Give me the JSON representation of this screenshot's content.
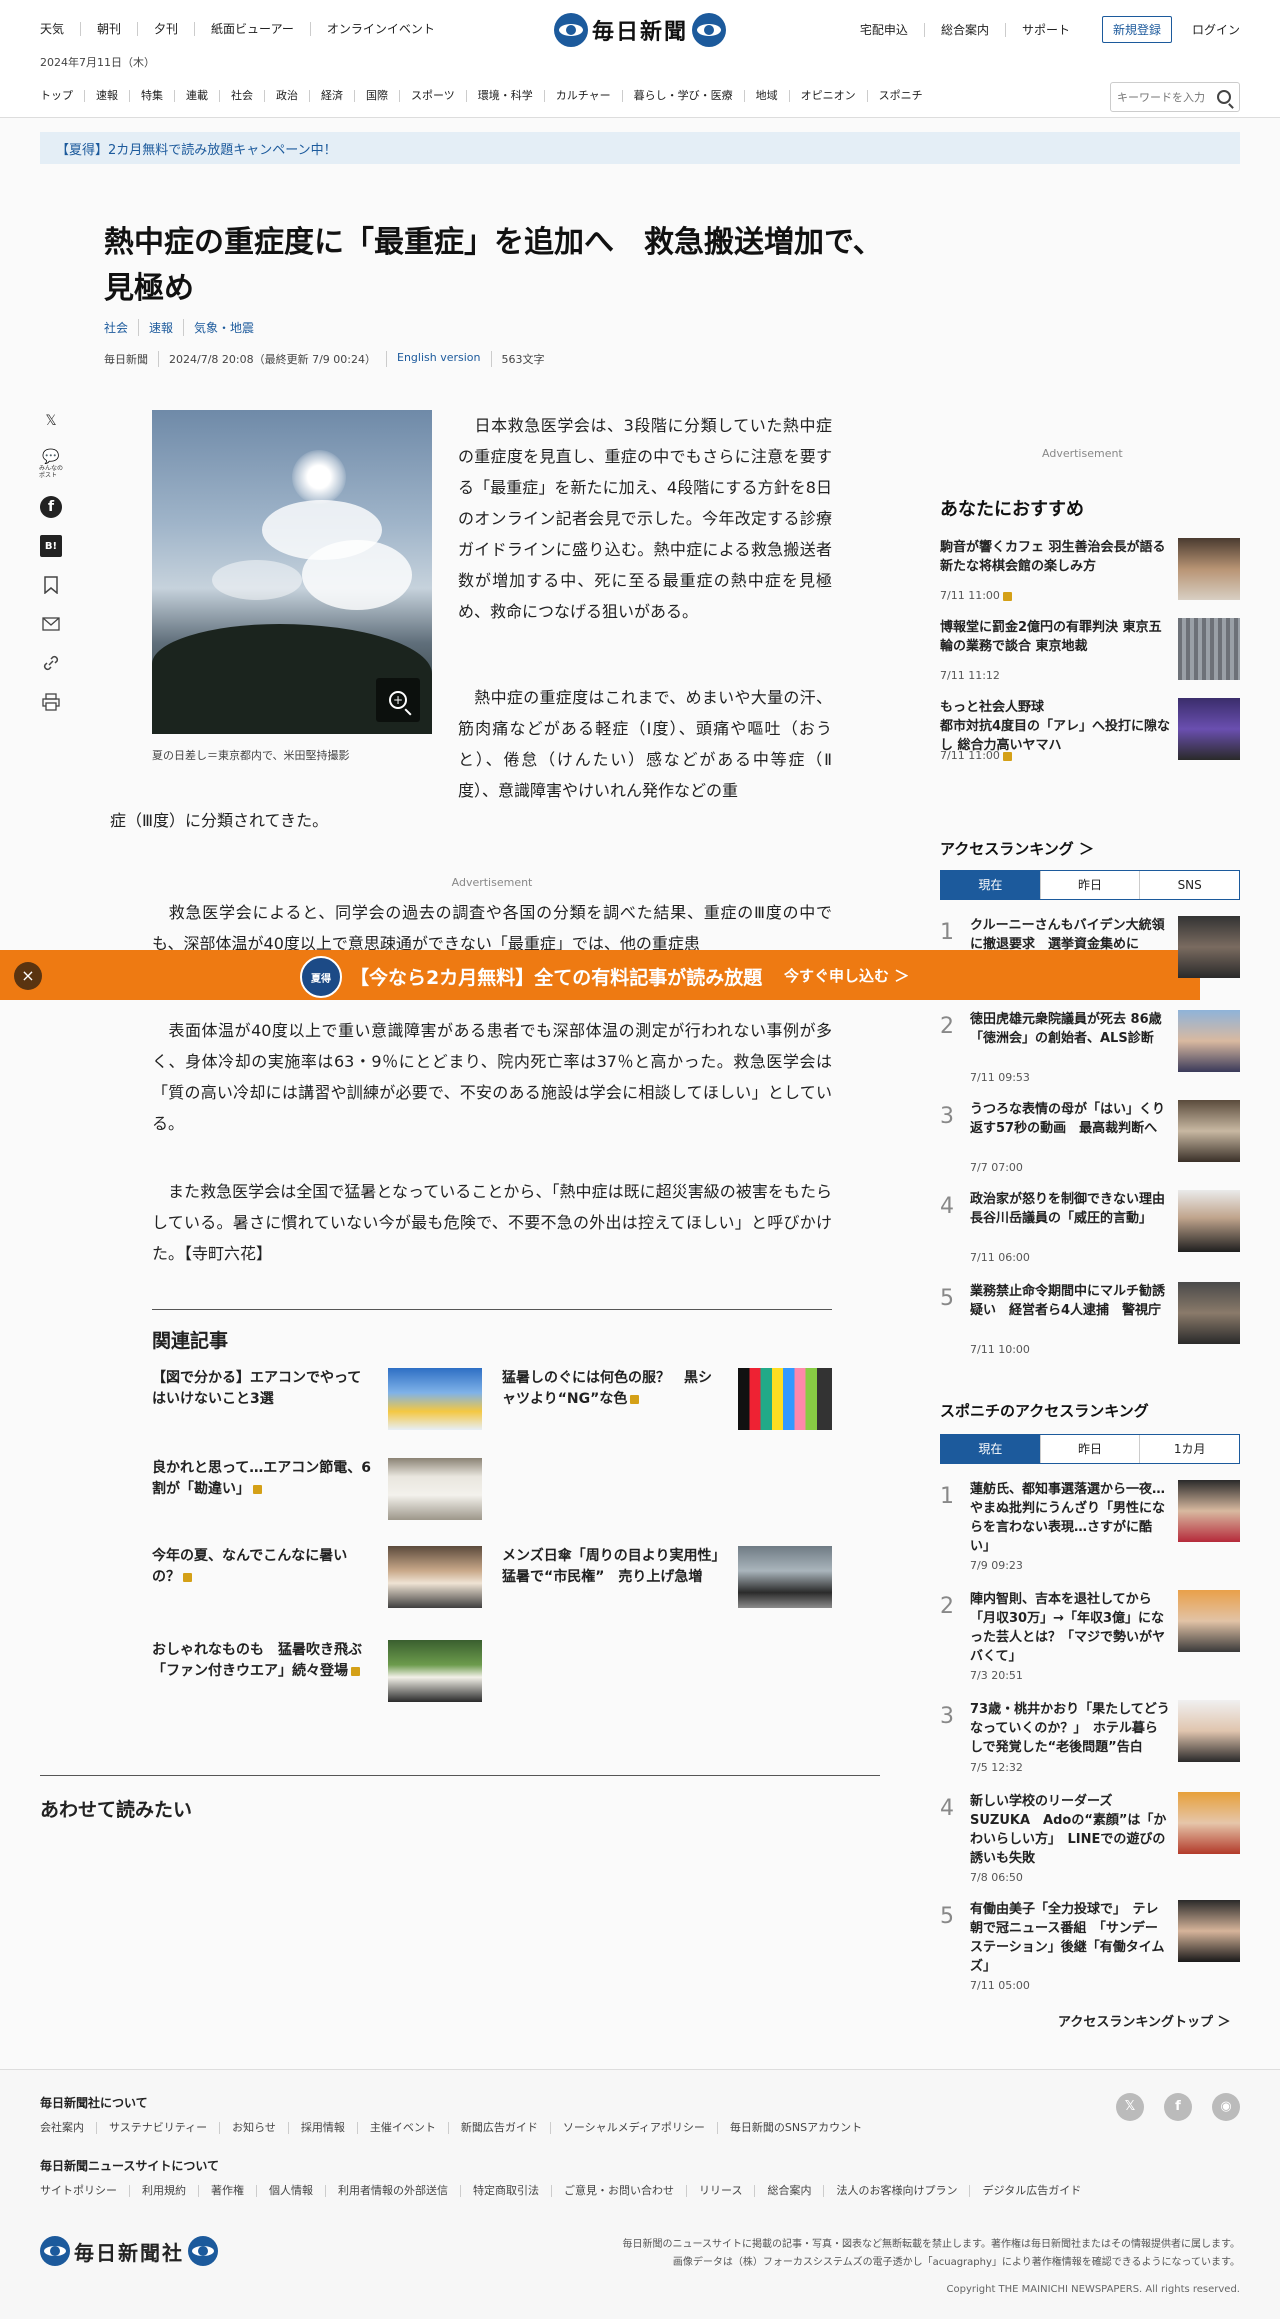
{
  "header": {
    "top_nav": [
      "天気",
      "朝刊",
      "夕刊",
      "紙面ビューアー",
      "オンラインイベント"
    ],
    "date": "2024年7月11日（木）",
    "logo_text": "毎日新聞",
    "right_nav": [
      "宅配申込",
      "総合案内",
      "サポート"
    ],
    "register": "新規登録",
    "login": "ログイン",
    "categories": [
      "トップ",
      "速報",
      "特集",
      "連載",
      "社会",
      "政治",
      "経済",
      "国際",
      "スポーツ",
      "環境・科学",
      "カルチャー",
      "暮らし・学び・医療",
      "地域",
      "オピニオン",
      "スポニチ"
    ],
    "search_placeholder": "キーワードを入力"
  },
  "promo": "【夏得】2カ月無料で読み放題キャンペーン中！",
  "article": {
    "headline": "熱中症の重症度に「最重症」を追加へ　救急搬送増加で、見極め",
    "tags": [
      "社会",
      "速報",
      "気象・地震"
    ],
    "meta": [
      "毎日新聞",
      "2024/7/8 20:08（最終更新 7/9 00:24）",
      "English version",
      "563文字"
    ],
    "share_icons": [
      "x-icon",
      "comment-icon",
      "facebook-icon",
      "hatena-icon",
      "bookmark-icon",
      "mail-icon",
      "link-icon",
      "print-icon"
    ],
    "comment_label": "みんなの\nポスト",
    "caption": "夏の日差し＝東京都内で、米田堅持撮影",
    "p1": "　日本救急医学会は、3段階に分類していた熱中症の重症度を見直し、重症の中でもさらに注意を要する「最重症」を新たに加え、4段階にする方針を8日のオンライン記者会見で示した。今年改定する診療ガイドラインに盛り込む。熱中症による救急搬送者数が増加する中、死に至る最重症の熱中症を見極め、救命につなげる狙いがある。",
    "p2a": "　熱中症の重症度はこれまで、めまいや大量の汗、筋肉痛などがある軽症（Ⅰ度）、頭痛や嘔吐（おうと）、倦怠（けんたい）感などがある中等症（Ⅱ度）、意識障害やけいれん発作などの重",
    "p2b": "症（Ⅲ度）に分類されてきた。",
    "ad_label": "Advertisement",
    "p3": "　救急医学会によると、同学会の過去の調査や各国の分類を調べた結果、重症のⅢ度の中でも、深部体温が40度以上で意思疎通ができない「最重症」では、他の重症患",
    "p4": "　表面体温が40度以上で重い意識障害がある患者でも深部体温の測定が行われない事例が多く、身体冷却の実施率は63・9％にとどまり、院内死亡率は37％と高かった。救急医学会は「質の高い冷却には講習や訓練が必要で、不安のある施設は学会に相談してほしい」としている。",
    "p5": "　また救急医学会は全国で猛暑となっていることから、「熱中症は既に超災害級の被害をもたらしている。暑さに慣れていない今が最も危険で、不要不急の外出は控えてほしい」と呼びかけた。【寺町六花】"
  },
  "banner": {
    "badge": "夏得",
    "text": "【今なら2カ月無料】全ての有料記事が読み放題",
    "cta": "今すぐ申し込む ＞",
    "close": "×"
  },
  "related": {
    "title": "関連記事",
    "items": [
      {
        "title": "【図で分かる】エアコンでやってはいけないこと3選",
        "locked": false
      },
      {
        "title": "猛暑しのぐには何色の服？　黒シャツより“NG”な色",
        "locked": true
      },
      {
        "title": "良かれと思って…エアコン節電、6割が「勘違い」",
        "locked": true
      },
      {
        "title": "今年の夏、なんでこんなに暑いの？",
        "locked": true
      },
      {
        "title": "メンズ日傘「周りの目より実用性」　猛暑で“市民権”　売り上げ急増",
        "locked": false
      },
      {
        "title": "おしゃれなものも　猛暑吹き飛ぶ「ファン付きウエア」続々登場",
        "locked": true
      }
    ]
  },
  "also_read": "あわせて読みたい",
  "sidebar": {
    "ad_label": "Advertisement",
    "rec_title": "あなたにおすすめ",
    "rec": [
      {
        "title": "駒音が響くカフェ 羽生善治会長が語る新たな将棋会館の楽しみ方",
        "time": "7/11 11:00",
        "locked": true
      },
      {
        "title": "博報堂に罰金2億円の有罪判決 東京五輪の業務で談合 東京地裁",
        "time": "7/11 11:12",
        "locked": false
      },
      {
        "title": "もっと社会人野球\n都市対抗4度目の「アレ」へ投打に隙なし 総合力高いヤマハ",
        "time": "7/11 11:00",
        "locked": true
      }
    ],
    "ranking_title": "アクセスランキング ＞",
    "ranking_tabs": [
      "現在",
      "昨日",
      "SNS"
    ],
    "ranking": [
      {
        "title": "クルーニーさんもバイデン大統領に撤退要求　選挙資金集めに",
        "time": ""
      },
      {
        "title": "徳田虎雄元衆院議員が死去 86歳 「徳洲会」の創始者、ALS診断",
        "time": "7/11 09:53"
      },
      {
        "title": "うつろな表情の母が「はい」くり返す57秒の動画　最高裁判断へ",
        "time": "7/7 07:00"
      },
      {
        "title": "政治家が怒りを制御できない理由　長谷川岳議員の「威圧的言動」",
        "time": "7/11 06:00"
      },
      {
        "title": "業務禁止命令期間中にマルチ勧誘疑い　経営者ら4人逮捕　警視庁",
        "time": "7/11 10:00"
      }
    ],
    "spn_title": "スポニチのアクセスランキング",
    "spn_tabs": [
      "現在",
      "昨日",
      "1カ月"
    ],
    "spn": [
      {
        "title": "蓮舫氏、都知事選落選から一夜…やまぬ批判にうんざり「男性にならを言わない表現…さすがに酷い」",
        "time": "7/9 09:23"
      },
      {
        "title": "陣内智則、吉本を退社してから「月収30万」→「年収3億」になった芸人とは？「マジで勢いがヤバくて」",
        "time": "7/3 20:51"
      },
      {
        "title": "73歳・桃井かおり「果たしてどうなっていくのか？」　ホテル暮らしで発覚した“老後問題”告白",
        "time": "7/5 12:32"
      },
      {
        "title": "新しい学校のリーダーズ　SUZUKA　Adoの“素顔”は「かわいらしい方」　LINEでの遊びの誘いも失敗",
        "time": "7/8 06:50"
      },
      {
        "title": "有働由美子「全力投球で」　テレ朝で冠ニュース番組　「サンデーステーション」後継「有働タイムズ」",
        "time": "7/11 05:00"
      }
    ],
    "ranking_top": "アクセスランキングトップ ＞"
  },
  "footer": {
    "about_title": "毎日新聞社について",
    "about_links": [
      "会社案内",
      "サステナビリティー",
      "お知らせ",
      "採用情報",
      "主催イベント",
      "新聞広告ガイド",
      "ソーシャルメディアポリシー",
      "毎日新聞のSNSアカウント"
    ],
    "site_title": "毎日新聞ニュースサイトについて",
    "site_links": [
      "サイトポリシー",
      "利用規約",
      "著作権",
      "個人情報",
      "利用者情報の外部送信",
      "特定商取引法",
      "ご意見・お問い合わせ",
      "リリース",
      "総合案内",
      "法人のお客様向けプラン",
      "デジタル広告ガイド"
    ],
    "logo_text": "毎日新聞社",
    "note1": "毎日新聞のニュースサイトに掲載の記事・写真・図表など無断転載を禁止します。著作権は毎日新聞社またはその情報提供者に属します。",
    "note2": "画像データは（株）フォーカスシステムズの電子透かし「acuagraphy」により著作権情報を確認できるようになっています。",
    "copyright": "Copyright THE MAINICHI NEWSPAPERS. All rights reserved."
  }
}
